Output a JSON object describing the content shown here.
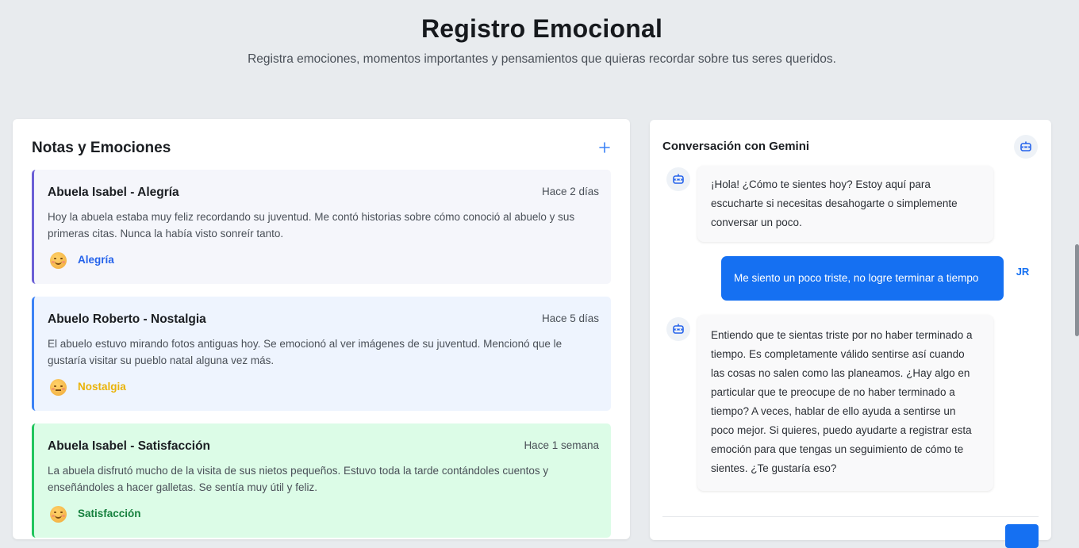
{
  "header": {
    "title": "Registro Emocional",
    "subtitle": "Registra emociones, momentos importantes y pensamientos que quieras recordar sobre tus seres queridos."
  },
  "notes": {
    "title": "Notas y Emociones",
    "add_icon": "plus-icon",
    "items": [
      {
        "title": "Abuela Isabel - Alegría",
        "time": "Hace 2 días",
        "body": "Hoy la abuela estaba muy feliz recordando su juventud. Me contó historias sobre cómo conoció al abuelo y sus primeras citas. Nunca la había visto sonreír tanto.",
        "emoji_icon": "smiling-face-icon",
        "tag": "Alegría",
        "tag_color": "#2563eb",
        "accent": "#6b5fd6"
      },
      {
        "title": "Abuelo Roberto - Nostalgia",
        "time": "Hace 5 días",
        "body": "El abuelo estuvo mirando fotos antiguas hoy. Se emocionó al ver imágenes de su juventud. Mencionó que le gustaría visitar su pueblo natal alguna vez más.",
        "emoji_icon": "pensive-face-icon",
        "tag": "Nostalgia",
        "tag_color": "#eab308",
        "accent": "#3b82f6"
      },
      {
        "title": "Abuela Isabel - Satisfacción",
        "time": "Hace 1 semana",
        "body": "La abuela disfrutó mucho de la visita de sus nietos pequeños. Estuvo toda la tarde contándoles cuentos y enseñándoles a hacer galletas. Se sentía muy útil y feliz.",
        "emoji_icon": "smiling-face-icon",
        "tag": "Satisfacción",
        "tag_color": "#15803d",
        "accent": "#22c55e"
      }
    ]
  },
  "chat": {
    "title": "Conversación con Gemini",
    "header_icon": "robot-icon",
    "messages": [
      {
        "from": "bot",
        "text": "¡Hola! ¿Cómo te sientes hoy? Estoy aquí para escucharte si necesitas desahogarte o simplemente conversar un poco."
      },
      {
        "from": "user",
        "avatar": "JR",
        "text": "Me siento un poco triste, no logre terminar a tiempo"
      },
      {
        "from": "bot",
        "text": "Entiendo que te sientas triste por no haber terminado a tiempo. Es completamente válido sentirse así cuando las cosas no salen como las planeamos. ¿Hay algo en particular que te preocupe de no haber terminado a tiempo? A veces, hablar de ello ayuda a sentirse un poco mejor. Si quieres, puedo ayudarte a registrar esta emoción para que tengas un seguimiento de cómo te sientes. ¿Te gustaría eso?"
      }
    ]
  },
  "colors": {
    "primary": "#1570f2",
    "background": "#e8ebee"
  }
}
